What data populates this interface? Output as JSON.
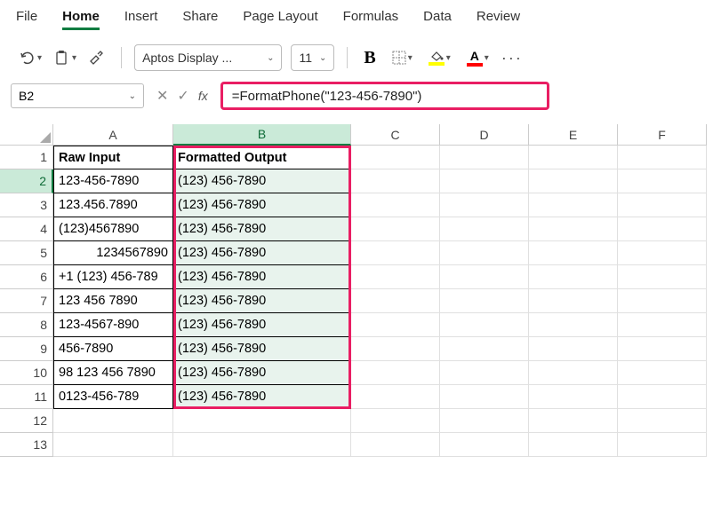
{
  "menu": {
    "file": "File",
    "home": "Home",
    "insert": "Insert",
    "share": "Share",
    "page_layout": "Page Layout",
    "formulas": "Formulas",
    "data": "Data",
    "review": "Review"
  },
  "ribbon": {
    "font_name": "Aptos Display ...",
    "font_size": "11",
    "bold": "B",
    "font_color_letter": "A",
    "fill_color": "#ffff00",
    "font_color": "#ff0000"
  },
  "namebox": "B2",
  "formula": "=FormatPhone(\"123-456-7890\")",
  "columns": [
    "A",
    "B",
    "C",
    "D",
    "E",
    "F"
  ],
  "headers": {
    "a": "Raw Input",
    "b": "Formatted Output"
  },
  "rows": [
    {
      "n": "1"
    },
    {
      "n": "2",
      "a": "123-456-7890",
      "b": "(123) 456-7890"
    },
    {
      "n": "3",
      "a": "123.456.7890",
      "b": "(123) 456-7890"
    },
    {
      "n": "4",
      "a": "(123)4567890",
      "b": "(123) 456-7890"
    },
    {
      "n": "5",
      "a": "1234567890",
      "b": "(123) 456-7890",
      "a_right": true
    },
    {
      "n": "6",
      "a": "+1 (123) 456-789",
      "b": "(123) 456-7890"
    },
    {
      "n": "7",
      "a": "123 456 7890",
      "b": "(123) 456-7890"
    },
    {
      "n": "8",
      "a": "123-4567-890",
      "b": "(123) 456-7890"
    },
    {
      "n": "9",
      "a": "456-7890",
      "b": "(123) 456-7890"
    },
    {
      "n": "10",
      "a": "98 123 456 7890",
      "b": "(123) 456-7890"
    },
    {
      "n": "11",
      "a": "0123-456-789",
      "b": "(123) 456-7890"
    },
    {
      "n": "12"
    },
    {
      "n": "13"
    }
  ]
}
